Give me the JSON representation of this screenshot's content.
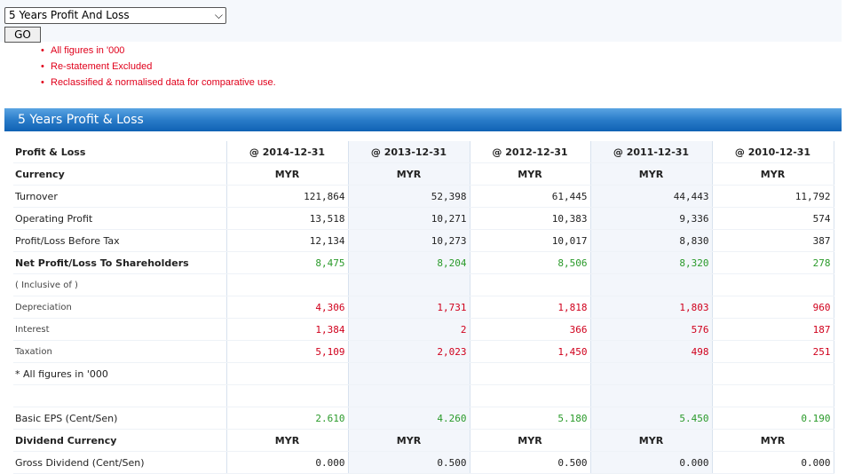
{
  "controls": {
    "selected_report": "5 Years Profit And Loss",
    "go_label": "GO"
  },
  "notes": [
    "All figures in '000",
    "Re-statement Excluded",
    "Reclassified & normalised data for comparative use."
  ],
  "section_title": "5 Years Profit & Loss",
  "table": {
    "header_label": "Profit & Loss",
    "periods": [
      "@ 2014-12-31",
      "@ 2013-12-31",
      "@ 2012-12-31",
      "@ 2011-12-31",
      "@ 2010-12-31"
    ],
    "rows": [
      {
        "label": "Currency",
        "style": "bold",
        "kind": "ctr",
        "values": [
          "MYR",
          "MYR",
          "MYR",
          "MYR",
          "MYR"
        ]
      },
      {
        "label": "Turnover",
        "kind": "num",
        "color": "black",
        "values": [
          "121,864",
          "52,398",
          "61,445",
          "44,443",
          "11,792"
        ]
      },
      {
        "label": "Operating Profit",
        "kind": "num",
        "color": "black",
        "values": [
          "13,518",
          "10,271",
          "10,383",
          "9,336",
          "574"
        ]
      },
      {
        "label": "Profit/Loss Before Tax",
        "kind": "num",
        "color": "black",
        "values": [
          "12,134",
          "10,273",
          "10,017",
          "8,830",
          "387"
        ]
      },
      {
        "label": "Net Profit/Loss To Shareholders",
        "style": "bold",
        "rule": true,
        "kind": "num",
        "color": "green",
        "values": [
          "8,475",
          "8,204",
          "8,506",
          "8,320",
          "278"
        ]
      },
      {
        "label": "( Inclusive of )",
        "style": "small",
        "kind": "num",
        "values": [
          "",
          "",
          "",
          "",
          ""
        ]
      },
      {
        "label": "Depreciation",
        "style": "small",
        "kind": "num",
        "color": "red",
        "values": [
          "4,306",
          "1,731",
          "1,818",
          "1,803",
          "960"
        ]
      },
      {
        "label": "Interest",
        "style": "small",
        "kind": "num",
        "color": "red",
        "values": [
          "1,384",
          "2",
          "366",
          "576",
          "187"
        ]
      },
      {
        "label": "Taxation",
        "style": "small",
        "kind": "num",
        "color": "red",
        "values": [
          "5,109",
          "2,023",
          "1,450",
          "498",
          "251"
        ]
      },
      {
        "label": "* All figures in '000",
        "kind": "num",
        "values": [
          "",
          "",
          "",
          "",
          ""
        ]
      },
      {
        "label": "",
        "kind": "num",
        "values": [
          "",
          "",
          "",
          "",
          ""
        ]
      },
      {
        "label": "Basic EPS (Cent/Sen)",
        "rule": true,
        "kind": "num",
        "color": "green",
        "values": [
          "2.610",
          "4.260",
          "5.180",
          "5.450",
          "0.190"
        ]
      },
      {
        "label": "Dividend Currency",
        "style": "bold",
        "kind": "ctr",
        "values": [
          "MYR",
          "MYR",
          "MYR",
          "MYR",
          "MYR"
        ]
      },
      {
        "label": "Gross Dividend (Cent/Sen)",
        "kind": "num",
        "color": "black",
        "values": [
          "0.000",
          "0.500",
          "0.500",
          "0.000",
          "0.000"
        ]
      }
    ]
  }
}
